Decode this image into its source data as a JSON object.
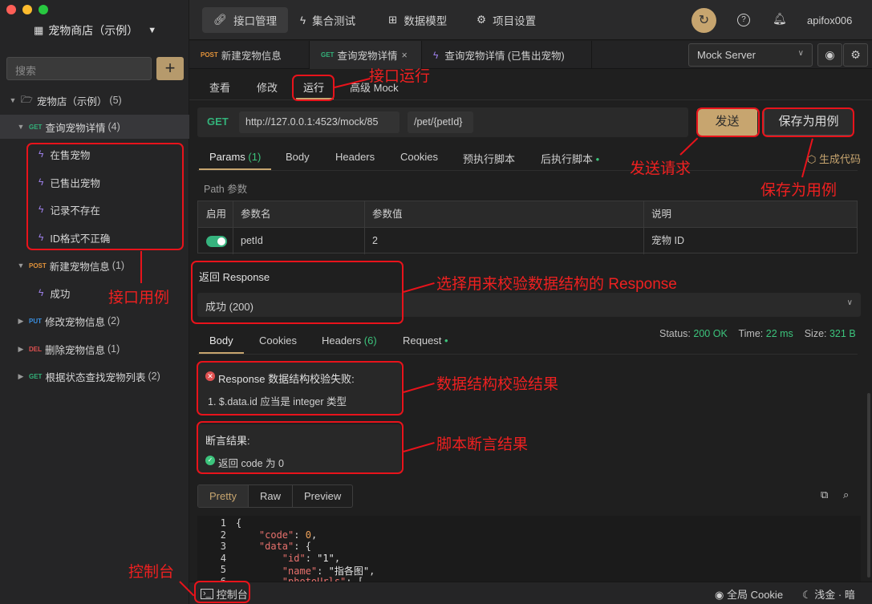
{
  "sidebar": {
    "workspace": "宠物商店（示例）",
    "search_placeholder": "搜索",
    "add": "+",
    "root": {
      "label": "宠物店（示例）",
      "count": "(5)"
    },
    "items": [
      {
        "method": "GET",
        "label": "查询宠物详情",
        "count": "(4)"
      },
      {
        "label": "在售宠物"
      },
      {
        "label": "已售出宠物"
      },
      {
        "label": "记录不存在"
      },
      {
        "label": "ID格式不正确"
      },
      {
        "method": "POST",
        "label": "新建宠物信息",
        "count": "(1)"
      },
      {
        "label": "成功"
      },
      {
        "method": "PUT",
        "label": "修改宠物信息",
        "count": "(2)"
      },
      {
        "method": "DEL",
        "label": "删除宠物信息",
        "count": "(1)"
      },
      {
        "method": "GET",
        "label": "根据状态查找宠物列表",
        "count": "(2)"
      }
    ]
  },
  "topnav": {
    "tabs": [
      "接口管理",
      "集合测试",
      "数据模型",
      "项目设置"
    ],
    "user": "apifox006"
  },
  "request_tabs": [
    {
      "method": "POST",
      "label": "新建宠物信息"
    },
    {
      "method": "GET",
      "label": "查询宠物详情",
      "close": "×"
    },
    {
      "label": "查询宠物详情 (已售出宠物)"
    }
  ],
  "env": {
    "selected": "Mock Server"
  },
  "subtabs": [
    "查看",
    "修改",
    "运行",
    "高级 Mock"
  ],
  "url": {
    "method": "GET",
    "base": "http://127.0.0.1:4523/mock/85",
    "path": "/pet/{petId}",
    "send": "发送",
    "save": "保存为用例"
  },
  "param_tabs": [
    "Params",
    "Body",
    "Headers",
    "Cookies",
    "预执行脚本",
    "后执行脚本"
  ],
  "params_count": "(1)",
  "gen_code": "生成代码",
  "path_params": {
    "title": "Path 参数",
    "headers": [
      "启用",
      "参数名",
      "参数值",
      "说明"
    ],
    "row": {
      "name": "petId",
      "value": "2",
      "desc": "宠物 ID"
    }
  },
  "response": {
    "label": "返回 Response",
    "selected": "成功 (200)"
  },
  "resp_tabs": [
    "Body",
    "Cookies",
    "Headers",
    "Request"
  ],
  "headers_count": "(6)",
  "status": {
    "status_label": "Status:",
    "status": "200 OK",
    "time_label": "Time:",
    "time": "22 ms",
    "size_label": "Size:",
    "size": "321 B"
  },
  "validation": {
    "title": "Response 数据结构校验失败:",
    "item": "1. $.data.id 应当是 integer 类型"
  },
  "assertion": {
    "title": "断言结果:",
    "item": "返回 code 为 0"
  },
  "view_tabs": [
    "Pretty",
    "Raw",
    "Preview"
  ],
  "code_lines": [
    {
      "n": "1",
      "t": "{"
    },
    {
      "n": "2",
      "k": "\"code\"",
      "v": "0",
      "vt": "n",
      "indent": "    ",
      "suffix": ","
    },
    {
      "n": "3",
      "k": "\"data\"",
      "v": "{",
      "vt": "p",
      "indent": "    ",
      "suffix": ""
    },
    {
      "n": "4",
      "k": "\"id\"",
      "v": "\"1\"",
      "vt": "s",
      "indent": "        ",
      "suffix": ","
    },
    {
      "n": "5",
      "k": "\"name\"",
      "v": "\"指各图\"",
      "vt": "s",
      "indent": "        ",
      "suffix": ","
    },
    {
      "n": "6",
      "k": "\"photoUrls\"",
      "v": "[",
      "vt": "p",
      "indent": "        ",
      "suffix": ""
    }
  ],
  "bottom": {
    "console": "控制台",
    "cookie": "全局 Cookie",
    "theme": "浅金 · 暗"
  },
  "annotations": {
    "run": "接口运行",
    "send": "发送请求",
    "save": "保存为用例",
    "cases": "接口用例",
    "resp": "选择用来校验数据结构的 Response",
    "validate": "数据结构校验结果",
    "assert": "脚本断言结果",
    "console": "控制台"
  },
  "colors": {
    "accent": "#c7a56f",
    "annotation": "#e8131b",
    "get": "#33b27a",
    "post": "#e1923a",
    "put": "#3a8fe0",
    "del": "#e05050"
  }
}
